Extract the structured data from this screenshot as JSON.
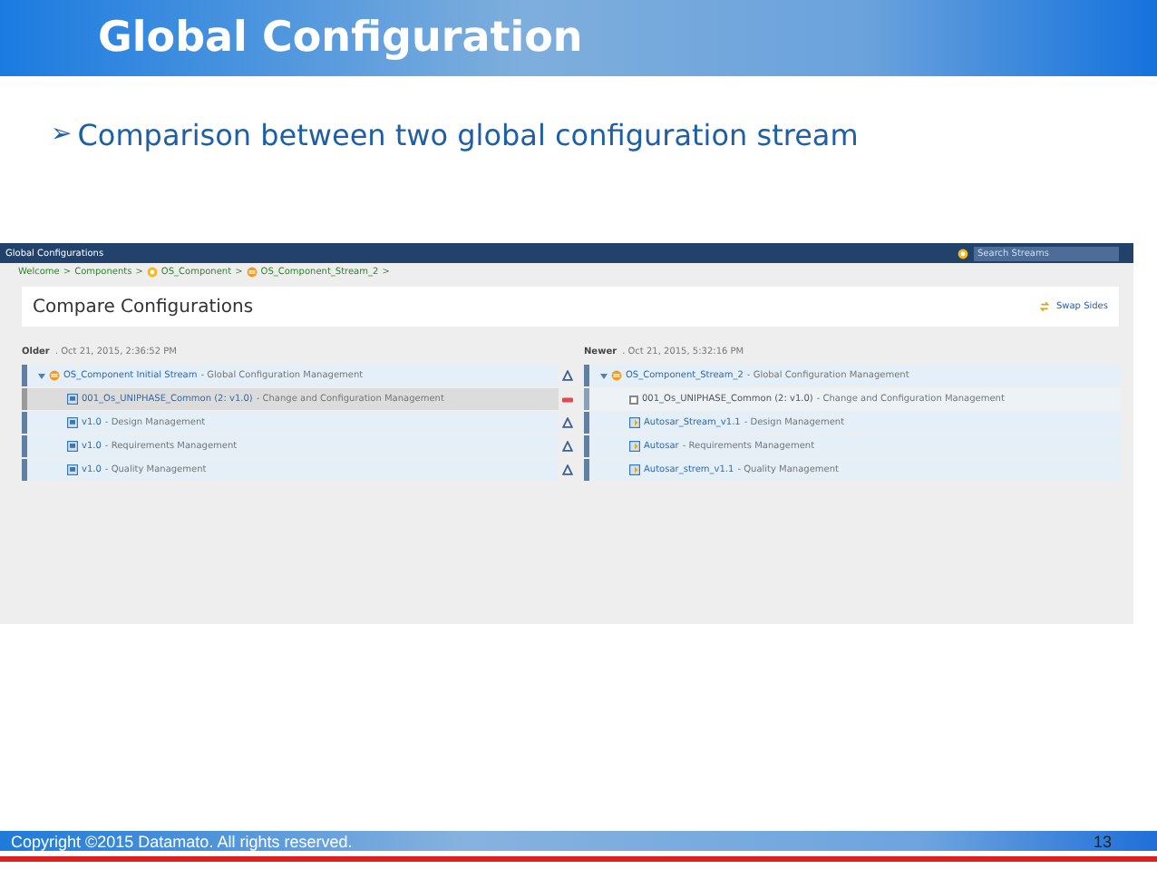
{
  "slide": {
    "title": "Global Configuration",
    "bullet_marker": "➢",
    "bullet": "Comparison between two global configuration stream"
  },
  "app": {
    "menu": "Global Configurations",
    "search": {
      "placeholder": "Search Streams"
    },
    "breadcrumbs": [
      {
        "label": "Welcome",
        "kind": "text"
      },
      {
        "label": "Components",
        "kind": "text"
      },
      {
        "label": "OS_Component",
        "kind": "component"
      },
      {
        "label": "OS_Component_Stream_2",
        "kind": "stream"
      }
    ],
    "separator": ">",
    "page_title": "Compare Configurations",
    "swap": "Swap Sides",
    "panes": [
      {
        "label": "Older",
        "date": ". Oct 21, 2015, 2:36:52 PM",
        "rows": [
          {
            "kind": "stream",
            "name": "OS_Component Initial Stream",
            "desc": " - Global Configuration Management",
            "modified": true,
            "removed": false
          },
          {
            "kind": "baseline",
            "name": "001_Os_UNIPHASE_Common (2: v1.0)",
            "desc": " - Change and Configuration Management",
            "modified": false,
            "removed": true
          },
          {
            "kind": "baseline",
            "name": "v1.0",
            "desc": " - Design Management",
            "modified": true,
            "removed": false
          },
          {
            "kind": "baseline",
            "name": "v1.0",
            "desc": " - Requirements Management",
            "modified": true,
            "removed": false
          },
          {
            "kind": "baseline",
            "name": "v1.0",
            "desc": " - Quality Management",
            "modified": true,
            "removed": false
          }
        ]
      },
      {
        "label": "Newer",
        "date": ". Oct 21, 2015, 5:32:16 PM",
        "rows": [
          {
            "kind": "stream",
            "name": "OS_Component_Stream_2",
            "desc": " - Global Configuration Management"
          },
          {
            "kind": "missing",
            "name": "001_Os_UNIPHASE_Common (2: v1.0)",
            "desc": " - Change and Configuration Management",
            "checked": false
          },
          {
            "kind": "configuration",
            "name": "Autosar_Stream_v1.1",
            "desc": " - Design Management"
          },
          {
            "kind": "configuration",
            "name": "Autosar",
            "desc": " - Requirements Management"
          },
          {
            "kind": "configuration",
            "name": "Autosar_strem_v1.1",
            "desc": " - Quality Management"
          }
        ]
      }
    ]
  },
  "footer": {
    "copyright": "Copyright ©2015 Datamato. All rights reserved.",
    "page": "13"
  }
}
